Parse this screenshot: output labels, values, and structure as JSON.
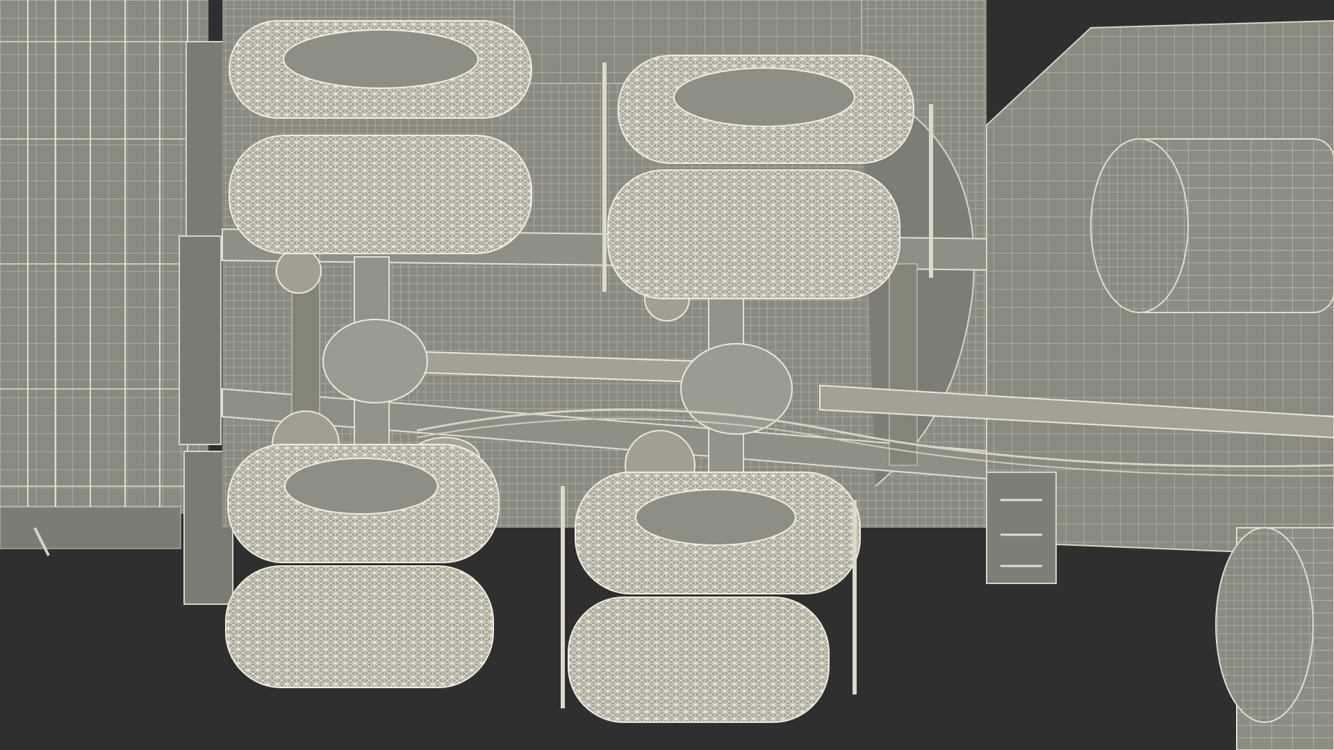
{
  "scene": {
    "subject": "truck-undercarriage-wireframe",
    "colors": {
      "background": "#2f2f2f",
      "body_fill": "#8a8a80",
      "body_dark": "#6e6e66",
      "wire": "#d8d6c8",
      "tire_fill": "#9c9a8e",
      "tire_light": "#e6e4d6"
    }
  }
}
